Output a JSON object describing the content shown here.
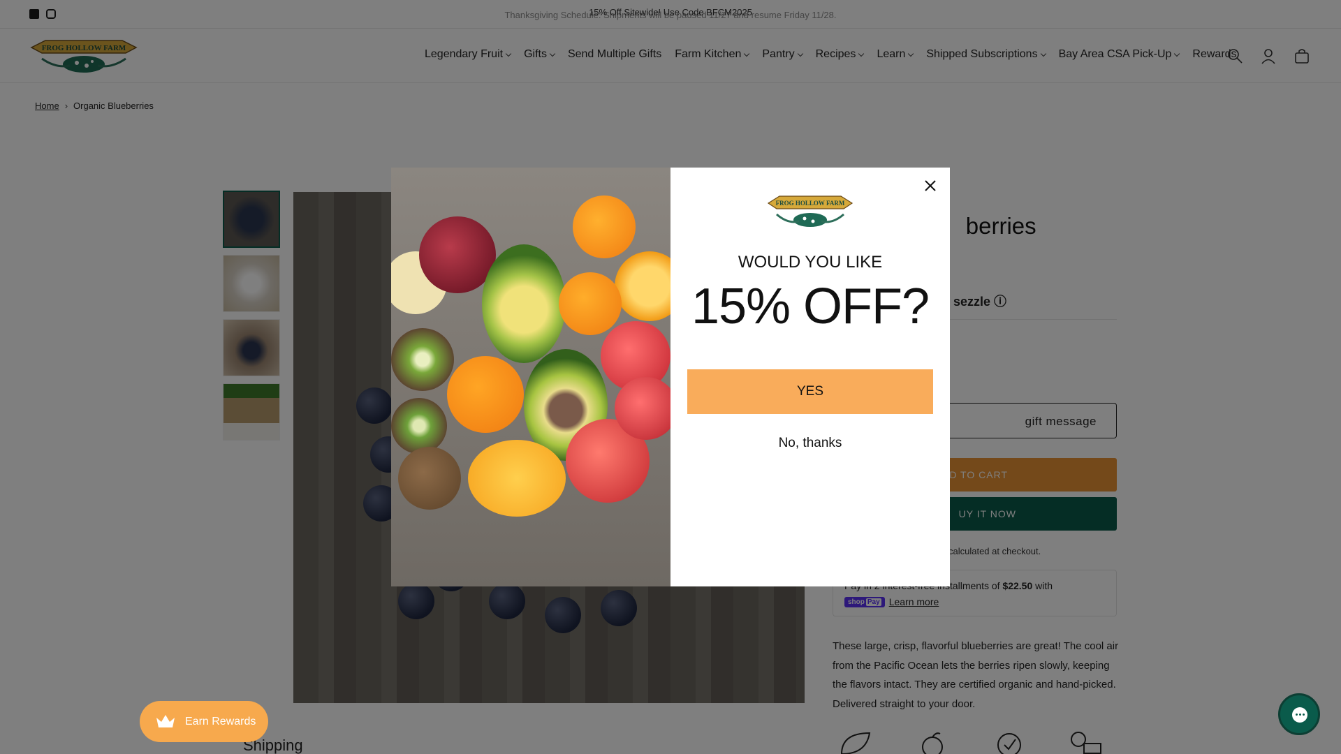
{
  "announcement": {
    "line1": "Thanksgiving Schedule: Shipments will be paused 11/27 and resume Friday 11/28.",
    "line2": "15% Off Sitewide! Use Code BFCM2025"
  },
  "social": [
    "facebook-icon",
    "instagram-icon"
  ],
  "brand": {
    "logo_text": "FROG HOLLOW FARM"
  },
  "nav": {
    "items": [
      {
        "label": "Legendary Fruit",
        "has_dropdown": true
      },
      {
        "label": "Gifts",
        "has_dropdown": true
      },
      {
        "label": "Send Multiple Gifts",
        "has_dropdown": false
      },
      {
        "label": "Farm Kitchen",
        "has_dropdown": true
      },
      {
        "label": "Pantry",
        "has_dropdown": true
      },
      {
        "label": "Recipes",
        "has_dropdown": true
      },
      {
        "label": "Learn",
        "has_dropdown": true
      },
      {
        "label": "Shipped Subscriptions",
        "has_dropdown": true
      },
      {
        "label": "Bay Area CSA Pick-Up",
        "has_dropdown": true
      },
      {
        "label": "Rewards",
        "has_dropdown": false
      }
    ],
    "icons": [
      "search-icon",
      "account-icon",
      "cart-icon"
    ]
  },
  "breadcrumb": {
    "home": "Home",
    "current": "Organic Blueberries"
  },
  "product": {
    "title_visible": "berries",
    "sezzle": "sezzle",
    "gift_button": "gift message",
    "add_to_cart": "DD TO CART",
    "buy_now": "UY IT NOW",
    "shipping_note": "calculated at checkout.",
    "installments_prefix": "Pay in 2 interest-free installments of",
    "installments_amount": "$22.50",
    "installments_suffix": "with",
    "shop_pay": "shop",
    "shop_pay_tag": "Pay",
    "learn_more": "Learn more",
    "description": "These large, crisp, flavorful blueberries are great! The cool air from the Pacific Ocean lets the berries ripen slowly, keeping the flavors intact. They are certified organic and hand-picked. Delivered straight to your door.",
    "section_heading": "Shipping"
  },
  "popup": {
    "question": "WOULD YOU LIKE",
    "offer": "15% OFF?",
    "yes_label": "YES",
    "no_label": "No, thanks"
  },
  "rewards_label": "Earn Rewards",
  "colors": {
    "accent_orange": "#f9ac5b",
    "brand_green": "#0a5b4b",
    "cart_orange": "#e89234"
  }
}
